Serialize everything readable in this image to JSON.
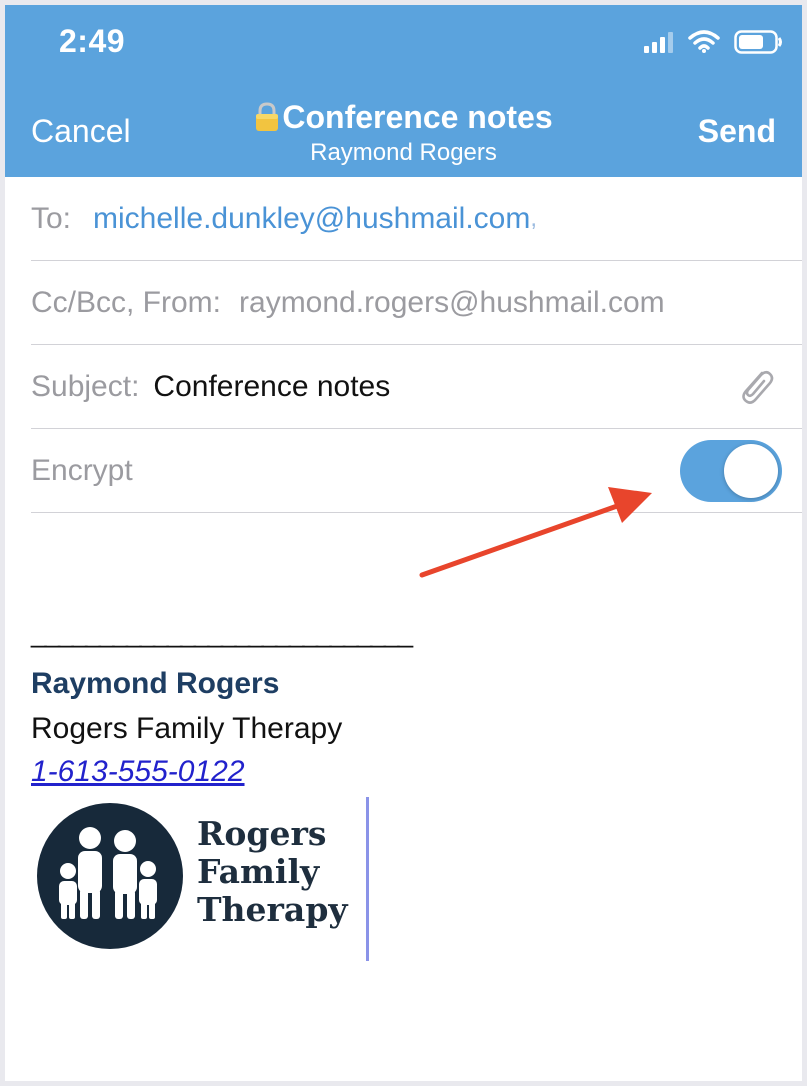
{
  "status_bar": {
    "time": "2:49"
  },
  "nav": {
    "cancel_label": "Cancel",
    "send_label": "Send",
    "title": "Conference notes",
    "subtitle": "Raymond Rogers"
  },
  "fields": {
    "to_label": "To:",
    "to_value": "michelle.dunkley@hushmail.com",
    "to_separator": ",",
    "ccbcc_label": "Cc/Bcc, From:",
    "from_value": "raymond.rogers@hushmail.com",
    "subject_label": "Subject:",
    "subject_value": "Conference notes",
    "encrypt_label": "Encrypt",
    "encrypt_on": true
  },
  "signature": {
    "separator": "____________________________",
    "name": "Raymond Rogers",
    "company": "Rogers Family Therapy",
    "phone": "1-613-555-0122",
    "logo_line1": "Rogers",
    "logo_line2": "Family",
    "logo_line3": "Therapy"
  },
  "colors": {
    "header_bg": "#5ba3dd",
    "link_blue": "#4a93d6",
    "annotation_arrow": "#e8452c",
    "logo_circle": "#17293a"
  },
  "icons": [
    "signal-icon",
    "wifi-icon",
    "battery-icon",
    "lock-icon",
    "paperclip-icon"
  ]
}
